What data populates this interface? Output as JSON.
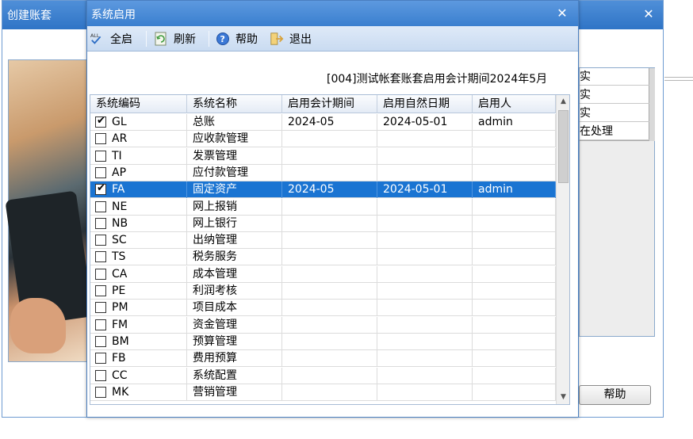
{
  "background_window": {
    "title": "创建账套",
    "close_glyph": "✕",
    "list_items": [
      "实",
      "实",
      "实",
      "在处理"
    ],
    "help_button": "帮助"
  },
  "dialog": {
    "title": "系统启用",
    "close_glyph": "✕",
    "toolbar": {
      "select_all": "全启",
      "select_all_icon_text": "ALL",
      "refresh": "刷新",
      "help": "帮助",
      "exit": "退出"
    },
    "info_text": "[004]测试帐套账套启用会计期间2024年5月",
    "grid": {
      "columns": [
        "系统编码",
        "系统名称",
        "启用会计期间",
        "启用自然日期",
        "启用人"
      ],
      "rows": [
        {
          "checked": true,
          "code": "GL",
          "name": "总账",
          "period": "2024-05",
          "date": "2024-05-01",
          "user": "admin",
          "selected": false
        },
        {
          "checked": false,
          "code": "AR",
          "name": "应收款管理",
          "period": "",
          "date": "",
          "user": "",
          "selected": false
        },
        {
          "checked": false,
          "code": "TI",
          "name": "发票管理",
          "period": "",
          "date": "",
          "user": "",
          "selected": false
        },
        {
          "checked": false,
          "code": "AP",
          "name": "应付款管理",
          "period": "",
          "date": "",
          "user": "",
          "selected": false
        },
        {
          "checked": true,
          "code": "FA",
          "name": "固定资产",
          "period": "2024-05",
          "date": "2024-05-01",
          "user": "admin",
          "selected": true
        },
        {
          "checked": false,
          "code": "NE",
          "name": "网上报销",
          "period": "",
          "date": "",
          "user": "",
          "selected": false
        },
        {
          "checked": false,
          "code": "NB",
          "name": "网上银行",
          "period": "",
          "date": "",
          "user": "",
          "selected": false
        },
        {
          "checked": false,
          "code": "SC",
          "name": "出纳管理",
          "period": "",
          "date": "",
          "user": "",
          "selected": false
        },
        {
          "checked": false,
          "code": "TS",
          "name": "税务服务",
          "period": "",
          "date": "",
          "user": "",
          "selected": false
        },
        {
          "checked": false,
          "code": "CA",
          "name": "成本管理",
          "period": "",
          "date": "",
          "user": "",
          "selected": false
        },
        {
          "checked": false,
          "code": "PE",
          "name": "利润考核",
          "period": "",
          "date": "",
          "user": "",
          "selected": false
        },
        {
          "checked": false,
          "code": "PM",
          "name": "项目成本",
          "period": "",
          "date": "",
          "user": "",
          "selected": false
        },
        {
          "checked": false,
          "code": "FM",
          "name": "资金管理",
          "period": "",
          "date": "",
          "user": "",
          "selected": false
        },
        {
          "checked": false,
          "code": "BM",
          "name": "预算管理",
          "period": "",
          "date": "",
          "user": "",
          "selected": false
        },
        {
          "checked": false,
          "code": "FB",
          "name": "费用预算",
          "period": "",
          "date": "",
          "user": "",
          "selected": false
        },
        {
          "checked": false,
          "code": "CC",
          "name": "系统配置",
          "period": "",
          "date": "",
          "user": "",
          "selected": false
        },
        {
          "checked": false,
          "code": "MK",
          "name": "营销管理",
          "period": "",
          "date": "",
          "user": "",
          "selected": false
        }
      ]
    },
    "scrollbar": {
      "up_glyph": "▲",
      "down_glyph": "▼"
    }
  },
  "colors": {
    "titlebar": "#3a7fcf",
    "selection": "#1a74d2",
    "toolbar": "#c9dbf1"
  },
  "icons": [
    "select-all-icon",
    "refresh-icon",
    "help-icon",
    "exit-icon",
    "close-icon",
    "checkbox-checked-icon"
  ]
}
